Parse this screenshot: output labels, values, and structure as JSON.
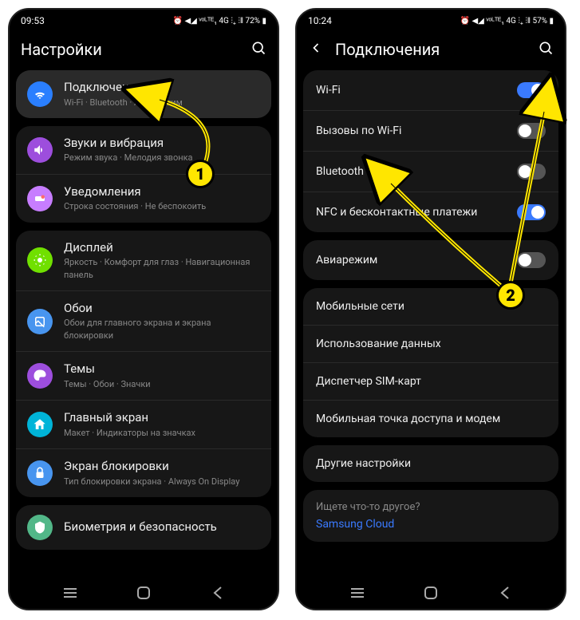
{
  "left": {
    "status": {
      "time": "09:53",
      "battery": "72%",
      "network": "⏰ ◀◢ ᵛᵒᴸᵀᴱ₁ 4G ⫶₊ ⫶‖ 72% ▮"
    },
    "header": {
      "title": "Настройки"
    },
    "items": [
      {
        "title": "Подключения",
        "sub": "Wi-Fi · Bluetooth · Авиарежим",
        "color": "#2a7fff",
        "icon": "wifi"
      },
      {
        "title": "Звуки и вибрация",
        "sub": "Режим звука · Мелодия звонка",
        "color": "#9d4edd",
        "icon": "sound"
      },
      {
        "title": "Уведомления",
        "sub": "Строка состояния · Не беспокоить",
        "color": "#c77dff",
        "icon": "bell"
      },
      {
        "title": "Дисплей",
        "sub": "Яркость · Комфорт для глаз · Навигационная панель",
        "color": "#70e000",
        "icon": "display"
      },
      {
        "title": "Обои",
        "sub": "Обои для главного экрана и экрана блокировки",
        "color": "#4895ef",
        "icon": "wallpaper"
      },
      {
        "title": "Темы",
        "sub": "Темы · Обои · Значки",
        "color": "#9d4edd",
        "icon": "themes"
      },
      {
        "title": "Главный экран",
        "sub": "Макет · Индикаторы на значках",
        "color": "#00b4d8",
        "icon": "home"
      },
      {
        "title": "Экран блокировки",
        "sub": "Тип блокировки экрана · Always On Display",
        "color": "#4895ef",
        "icon": "lock"
      },
      {
        "title": "Биометрия и безопасность",
        "sub": "",
        "color": "#52b788",
        "icon": "security"
      }
    ]
  },
  "right": {
    "status": {
      "time": "10:24",
      "battery": "57%",
      "network": "⏰ ◀◢ ᵛᵒᴸᵀᴱ₁ 4G ⫶₊ ⫶‖ 57% ▮"
    },
    "header": {
      "title": "Подключения"
    },
    "group1": [
      {
        "label": "Wi-Fi",
        "toggle": true,
        "on": true
      },
      {
        "label": "Вызовы по Wi-Fi",
        "toggle": true,
        "on": false
      },
      {
        "label": "Bluetooth",
        "toggle": true,
        "on": false
      },
      {
        "label": "NFC и бесконтактные платежи",
        "toggle": true,
        "on": true
      }
    ],
    "group2": [
      {
        "label": "Авиарежим",
        "toggle": true,
        "on": false
      }
    ],
    "group3": [
      {
        "label": "Мобильные сети",
        "toggle": false
      },
      {
        "label": "Использование данных",
        "toggle": false
      },
      {
        "label": "Диспетчер SIM-карт",
        "toggle": false
      },
      {
        "label": "Мобильная точка доступа и модем",
        "toggle": false
      }
    ],
    "group4": [
      {
        "label": "Другие настройки",
        "toggle": false
      }
    ],
    "other": {
      "title": "Ищете что-то другое?",
      "link": "Samsung Cloud"
    }
  },
  "markers": {
    "m1": "1",
    "m2": "2"
  }
}
